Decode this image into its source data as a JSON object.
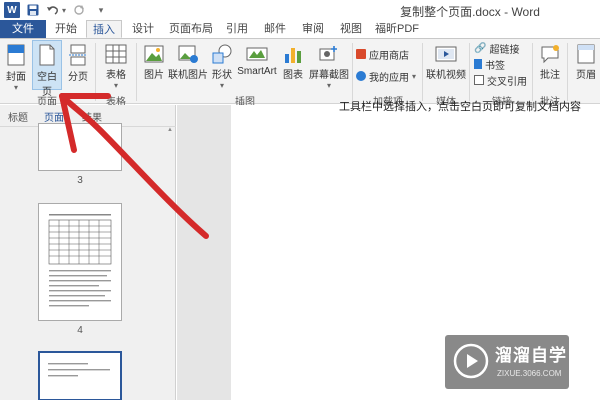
{
  "titlebar": {
    "app_icon": "W",
    "save_icon": "floppy-disk-icon",
    "undo_icon": "undo-icon",
    "redo_icon": "redo-icon",
    "customize_icon": "dropdown-icon",
    "doc_title": "复制整个页面.docx - Word"
  },
  "tabs": [
    {
      "label": "文件"
    },
    {
      "label": "开始"
    },
    {
      "label": "插入"
    },
    {
      "label": "设计"
    },
    {
      "label": "页面布局"
    },
    {
      "label": "引用"
    },
    {
      "label": "邮件"
    },
    {
      "label": "审阅"
    },
    {
      "label": "视图"
    },
    {
      "label": "福昕PDF"
    }
  ],
  "ribbon": {
    "pages_group": {
      "label": "页面",
      "cover": "封面",
      "blank": "空白页",
      "break": "分页"
    },
    "table_group": {
      "label": "表格",
      "table": "表格"
    },
    "illustrations_group": {
      "label": "插图",
      "picture": "图片",
      "online_picture": "联机图片",
      "shapes": "形状",
      "smartart": "SmartArt",
      "chart": "图表",
      "screenshot": "屏幕截图"
    },
    "addins_group": {
      "label": "加载项",
      "store": "应用商店",
      "my_apps": "我的应用"
    },
    "media_group": {
      "label": "媒体",
      "online_video": "联机视频"
    },
    "links_group": {
      "label": "链接",
      "hyperlink": "超链接",
      "bookmark": "书签",
      "cross_ref": "交叉引用"
    },
    "comments_group": {
      "label": "批注",
      "comment": "批注"
    },
    "header_group": {
      "header": "页眉"
    }
  },
  "nav_pane": {
    "tabs": [
      "标题",
      "页面",
      "结果"
    ],
    "active_tab": "页面",
    "pages": [
      {
        "number": "3"
      },
      {
        "number": "4"
      }
    ]
  },
  "document": {
    "visible_text": "工具栏中选择插入，点击空白页即可复制文档内容"
  },
  "watermark": {
    "name": "溜溜自学",
    "url": "ZIXUE.3066.COM"
  },
  "colors": {
    "accent": "#2b579a",
    "annotation": "#d42a2a"
  }
}
